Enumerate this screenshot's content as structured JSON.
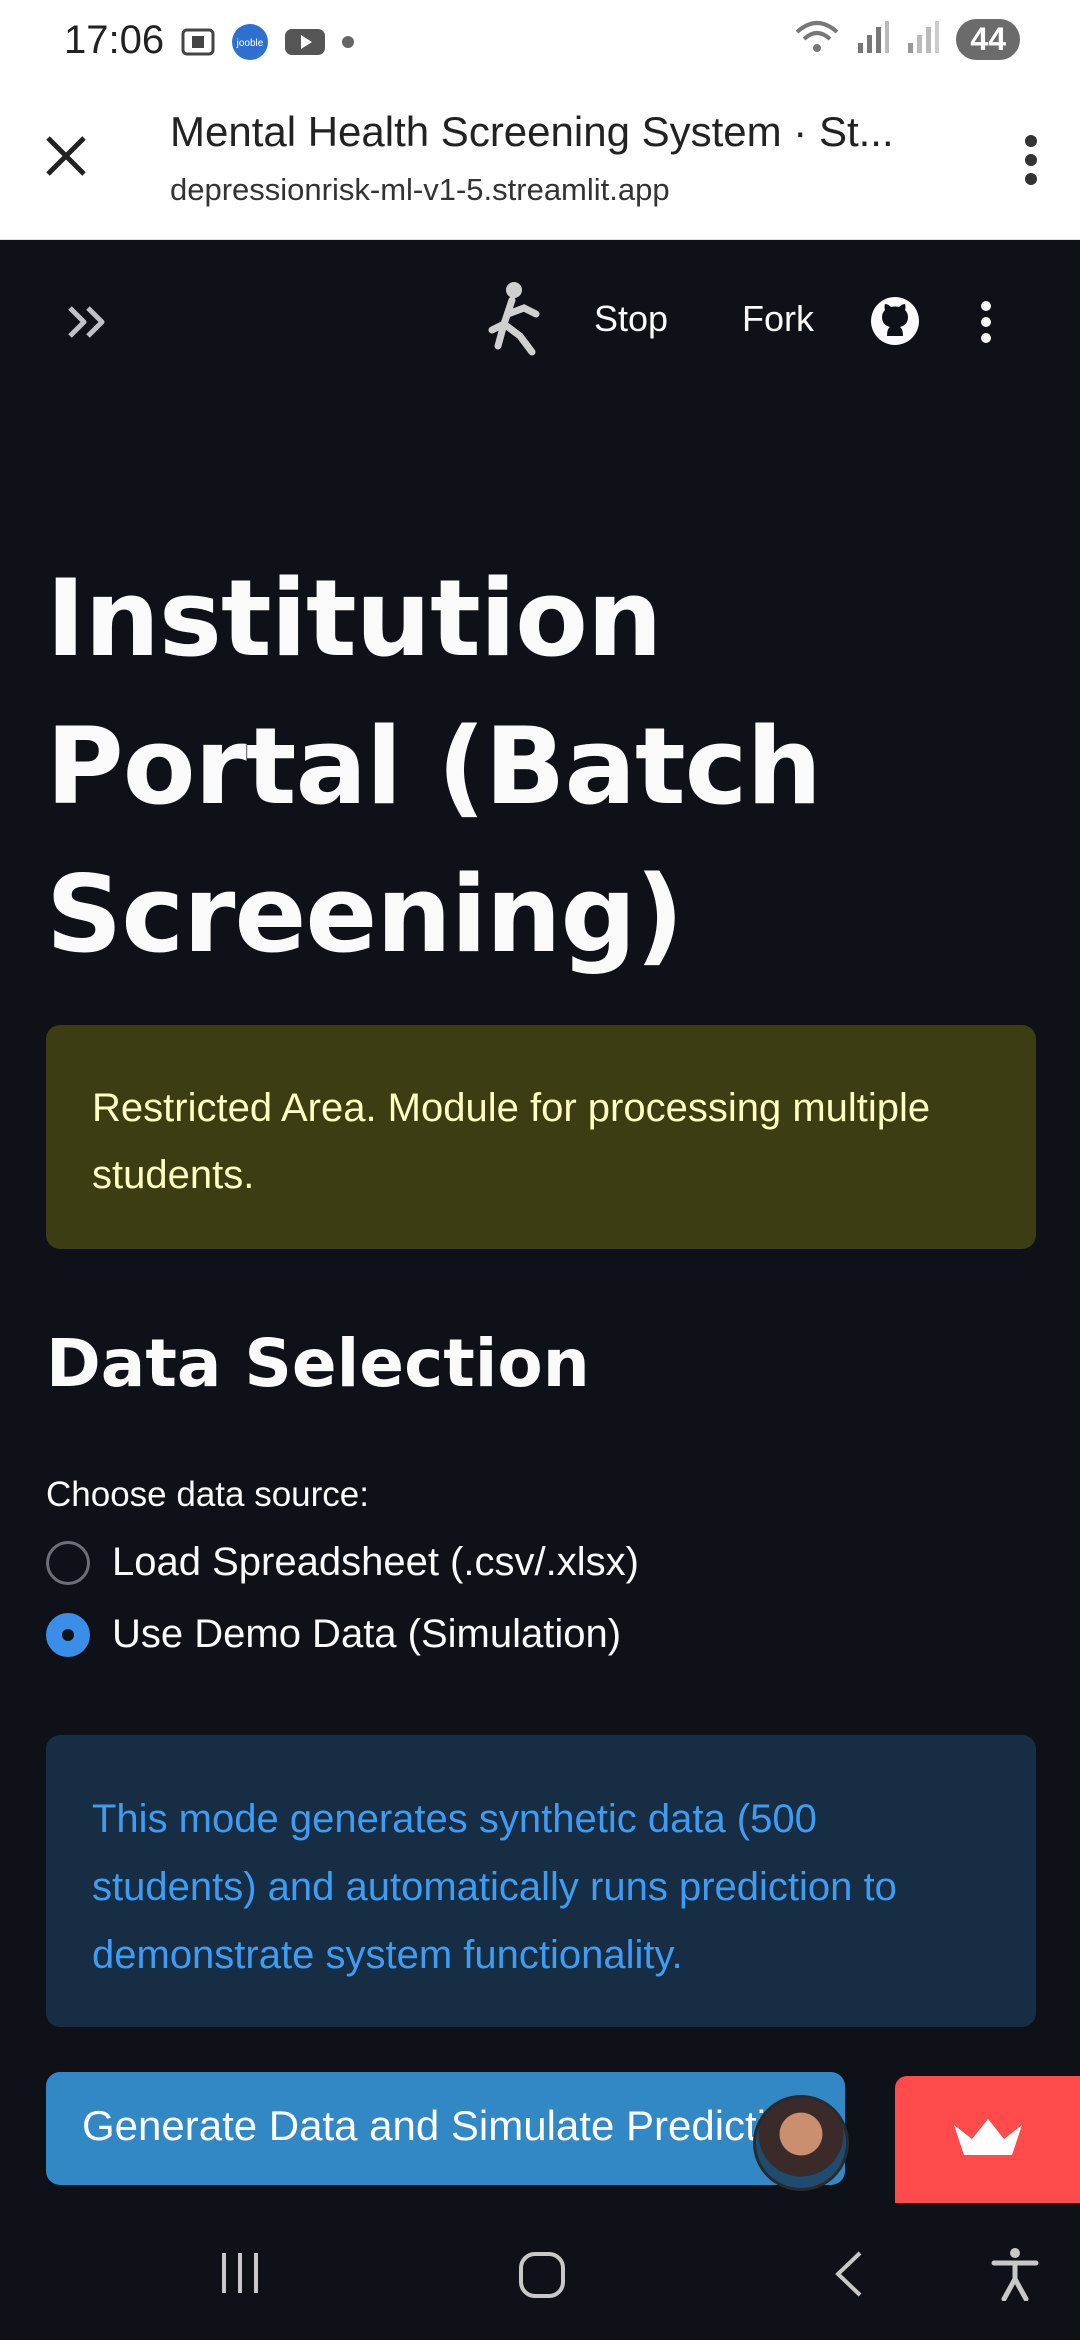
{
  "status_bar": {
    "time": "17:06",
    "battery": "44",
    "app_icons": [
      "screenshot-icon",
      "jooble-icon",
      "youtube-icon",
      "dot-icon"
    ]
  },
  "browser": {
    "title": "Mental Health Screening System · St...",
    "url": "depressionrisk-ml-v1-5.streamlit.app"
  },
  "toolbar": {
    "stop_label": "Stop",
    "fork_label": "Fork"
  },
  "main": {
    "title": "Institution Portal (Batch Screening)",
    "warning_text": "Restricted Area. Module for processing multiple students.",
    "section_heading": "Data Selection",
    "radio_group": {
      "label": "Choose data source:",
      "options": [
        {
          "label": "Load Spreadsheet (.csv/.xlsx)",
          "selected": false
        },
        {
          "label": "Use Demo Data (Simulation)",
          "selected": true
        }
      ]
    },
    "info_text": "This mode generates synthetic data (500 students) and automatically runs prediction to demonstrate system functionality.",
    "primary_button_label": "Generate Data and Simulate Predicti"
  },
  "colors": {
    "background": "#0e1117",
    "warning_bg": "#3d3d14",
    "warning_text": "#ffffc2",
    "info_bg": "#172d43",
    "info_text": "#3e9cf2",
    "primary": "#3287c5",
    "streamlit_red": "#ff4b4b",
    "radio_accent": "#3a8ee8"
  }
}
